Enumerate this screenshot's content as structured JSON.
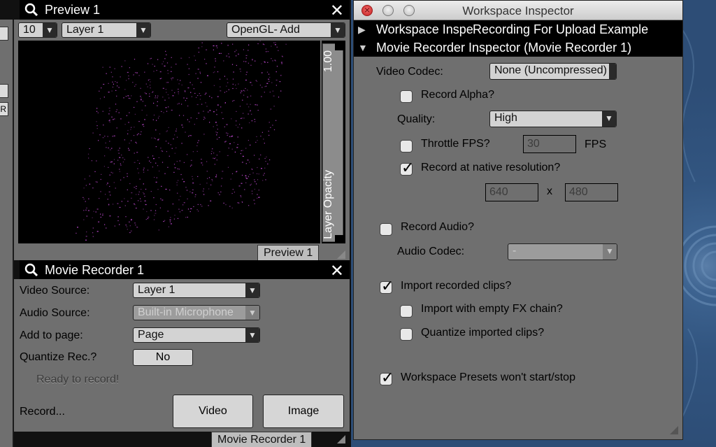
{
  "colors": {
    "particle": "#c64cd8",
    "panel_bg": "#6f6f6f",
    "title_bg": "#000000"
  },
  "preview": {
    "title": "Preview 1",
    "layer_num": "10",
    "layer": "Layer 1",
    "blend_mode": "OpenGL- Add",
    "opacity_label": "Layer Opacity",
    "opacity_value": "1.00",
    "opacity_level": 1.0,
    "tab_label": "Preview 1"
  },
  "recorder": {
    "title": "Movie Recorder 1",
    "video_source_label": "Video Source:",
    "video_source": "Layer 1",
    "audio_source_label": "Audio Source:",
    "audio_source": "Built-in Microphone",
    "add_to_page_label": "Add to page:",
    "add_to_page": "Page",
    "quantize_label": "Quantize Rec.?",
    "quantize_value": "No",
    "status": "Ready to record!",
    "record_label": "Record...",
    "video_button": "Video",
    "image_button": "Image",
    "tab_label": "Movie Recorder 1"
  },
  "inspector": {
    "window_title": "Workspace Inspector",
    "section1_a": "Workspace Inspe",
    "section1_b": "Recording For Upload Example",
    "section2": "Movie Recorder Inspector  (Movie Recorder 1)",
    "video_codec_label": "Video Codec:",
    "video_codec": "None (Uncompressed)",
    "record_alpha": {
      "label": "Record Alpha?",
      "checked": false
    },
    "quality_label": "Quality:",
    "quality": "High",
    "throttle_fps": {
      "label": "Throttle FPS?",
      "checked": false
    },
    "fps_value": "30",
    "fps_unit": "FPS",
    "native_res": {
      "label": "Record at native resolution?",
      "checked": true
    },
    "width": "640",
    "times": "x",
    "height": "480",
    "record_audio": {
      "label": "Record Audio?",
      "checked": false
    },
    "audio_codec_label": "Audio Codec:",
    "audio_codec": "-",
    "import_clips": {
      "label": "Import recorded clips?",
      "checked": true
    },
    "import_empty_fx": {
      "label": "Import with empty FX chain?",
      "checked": false
    },
    "quantize_clips": {
      "label": "Quantize imported clips?",
      "checked": false
    },
    "presets": {
      "label": "Workspace Presets won't start/stop",
      "checked": true
    }
  }
}
